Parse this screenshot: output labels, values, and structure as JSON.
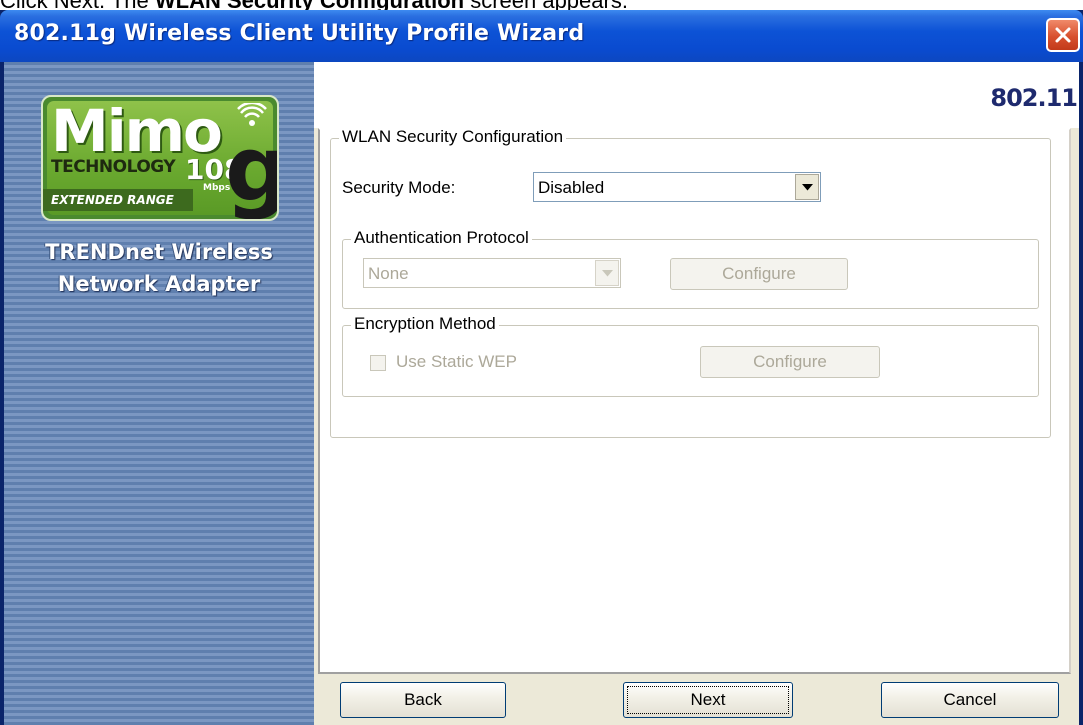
{
  "caption": {
    "prefix": "Click Next.  The ",
    "bold": "WLAN Security Configuration",
    "suffix": " screen appears."
  },
  "window": {
    "title": "802.11g Wireless Client Utility Profile Wizard",
    "close_icon": "close-icon"
  },
  "banner": {
    "logo": {
      "mimo": "Mimo",
      "tech": "TECHNOLOGY",
      "rate": "108",
      "unit": "Mbps",
      "g": "g",
      "range": "EXTENDED RANGE"
    },
    "line1": "TRENDnet Wireless",
    "line2": "Network Adapter"
  },
  "header": {
    "brand": "802.11"
  },
  "wlan_group": {
    "legend": "WLAN Security Configuration",
    "security_mode_label": "Security Mode:",
    "security_mode_value": "Disabled"
  },
  "auth_group": {
    "legend": "Authentication Protocol",
    "protocol_value": "None",
    "configure_label": "Configure"
  },
  "enc_group": {
    "legend": "Encryption Method",
    "static_wep_label": "Use Static WEP",
    "static_wep_checked": false,
    "configure_label": "Configure"
  },
  "footer": {
    "back_label": "Back",
    "next_label": "Next",
    "cancel_label": "Cancel"
  },
  "colors": {
    "title_bar": "#0a4bd0",
    "banner": "#6a88b6",
    "dialog_bg": "#ece9d8",
    "close_button": "#d8502e",
    "logo_green": "#6aa92f"
  }
}
